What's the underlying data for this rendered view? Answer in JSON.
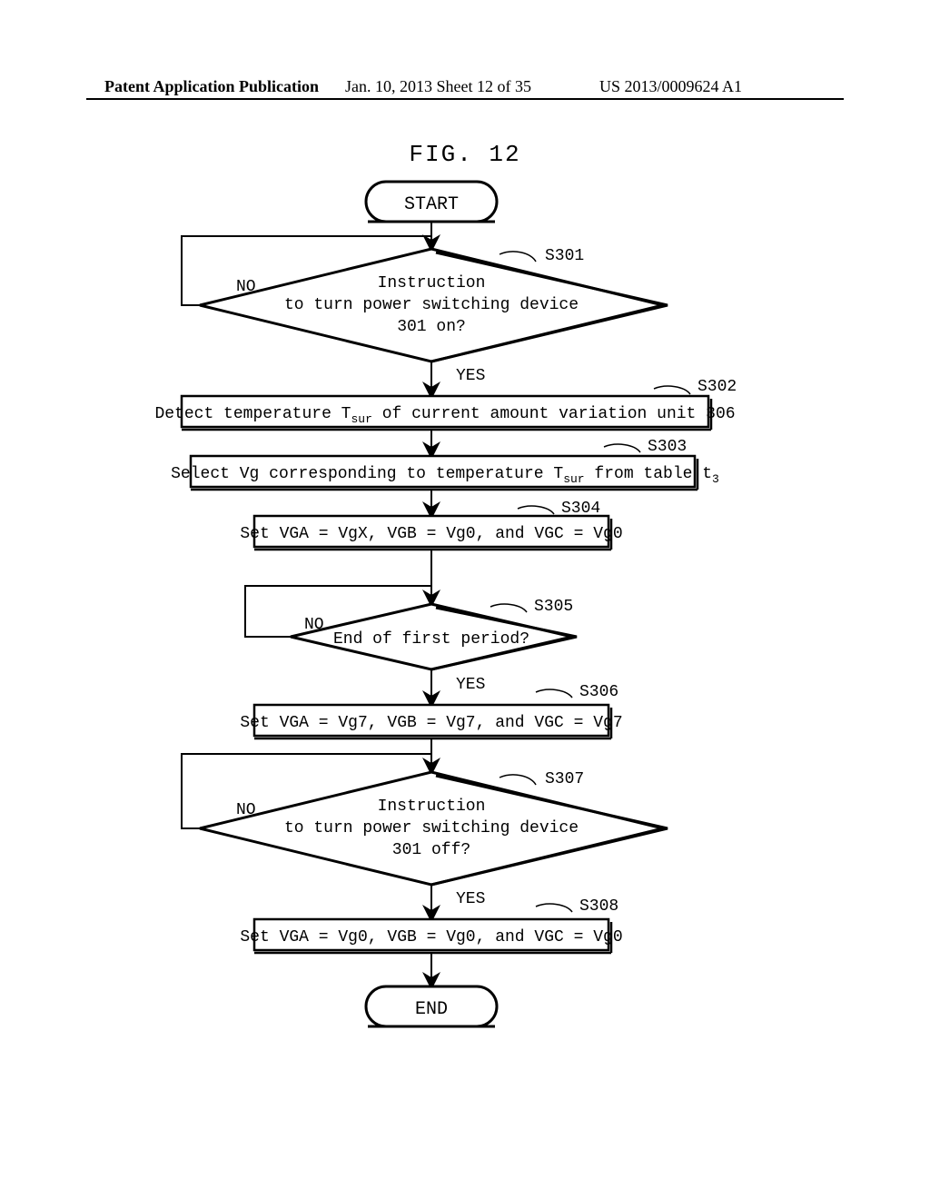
{
  "header": {
    "left": "Patent Application Publication",
    "center": "Jan. 10, 2013  Sheet 12 of 35",
    "right": "US 2013/0009624 A1"
  },
  "fig_no": "FIG. 12",
  "nodes": {
    "start": "START",
    "end": "END",
    "s301": {
      "tag": "S301",
      "l1": "Instruction",
      "l2": "to turn power switching device",
      "l3": "301 on?",
      "yes": "YES",
      "no": "NO"
    },
    "s302": {
      "tag": "S302",
      "pre": "Detect temperature T",
      "sub": "sur",
      "post": " of current amount variation unit 306"
    },
    "s303": {
      "tag": "S303",
      "pre": "Select Vg corresponding to temperature T",
      "sub": "sur",
      "mid": " from table t",
      "sub2": "3"
    },
    "s304": {
      "tag": "S304",
      "txt": "Set VGA = VgX,  VGB = Vg0, and VGC = Vg0"
    },
    "s305": {
      "tag": "S305",
      "txt": "End of first period?",
      "yes": "YES",
      "no": "NO"
    },
    "s306": {
      "tag": "S306",
      "txt": "Set VGA = Vg7,  VGB = Vg7, and VGC = Vg7"
    },
    "s307": {
      "tag": "S307",
      "l1": "Instruction",
      "l2": "to turn power switching device",
      "l3": "301 off?",
      "yes": "YES",
      "no": "NO"
    },
    "s308": {
      "tag": "S308",
      "txt": "Set VGA = Vg0,  VGB = Vg0, and VGC = Vg0"
    }
  }
}
